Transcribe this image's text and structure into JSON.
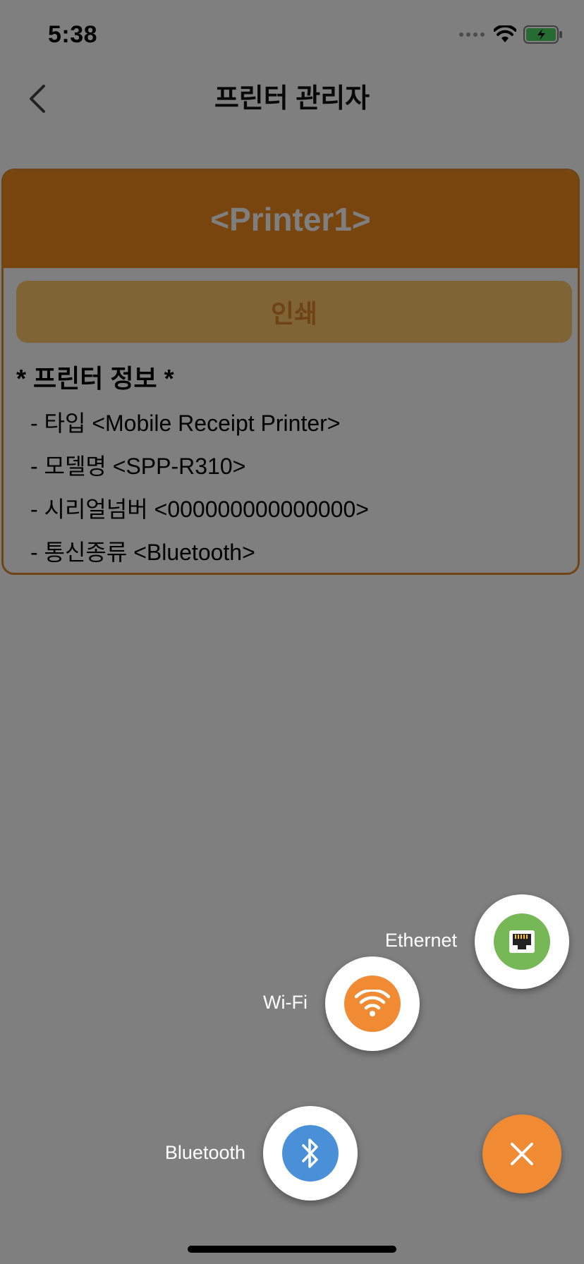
{
  "status_bar": {
    "time": "5:38"
  },
  "nav": {
    "title": "프린터 관리자",
    "back_icon": "chevron-left-icon"
  },
  "printer_card": {
    "title": "<Printer1>",
    "print_button_label": "인쇄",
    "info_header": "* 프린터 정보 *",
    "info_lines": [
      "- 타입 <Mobile Receipt Printer>",
      "- 모델명 <SPP-R310>",
      "- 시리얼넘버 <000000000000000>",
      "- 통신종류 <Bluetooth>"
    ]
  },
  "fab_menu": {
    "options": [
      {
        "label": "Ethernet",
        "icon": "ethernet-icon",
        "color": "#76b856"
      },
      {
        "label": "Wi-Fi",
        "icon": "wifi-icon",
        "color": "#f08a33"
      },
      {
        "label": "Bluetooth",
        "icon": "bluetooth-icon",
        "color": "#4a90d9"
      }
    ],
    "close_icon": "close-icon",
    "close_color": "#f08a33"
  },
  "colors": {
    "accent": "#f18b1f",
    "print_button_bg": "#ffc96b",
    "overlay": "rgba(0,0,0,0.5)"
  }
}
